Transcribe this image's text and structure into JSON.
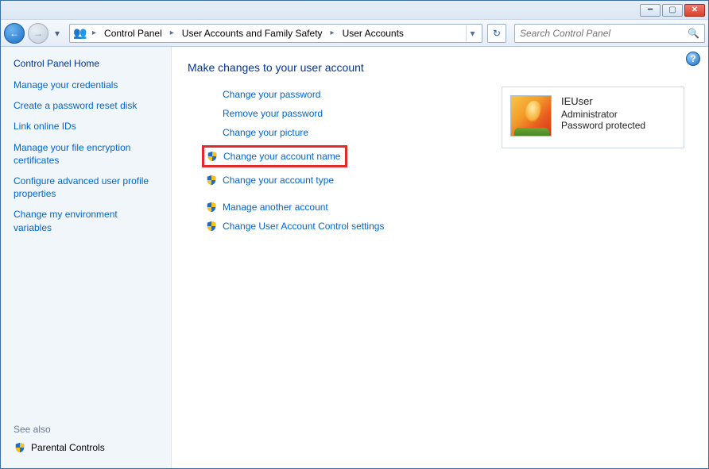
{
  "breadcrumb": {
    "items": [
      "Control Panel",
      "User Accounts and Family Safety",
      "User Accounts"
    ]
  },
  "search": {
    "placeholder": "Search Control Panel"
  },
  "sidebar": {
    "home": "Control Panel Home",
    "links": [
      "Manage your credentials",
      "Create a password reset disk",
      "Link online IDs",
      "Manage your file encryption certificates",
      "Configure advanced user profile properties",
      "Change my environment variables"
    ],
    "see_also": "See also",
    "parental": "Parental Controls"
  },
  "main": {
    "heading": "Make changes to your user account",
    "group1": [
      {
        "label": "Change your password",
        "shield": false
      },
      {
        "label": "Remove your password",
        "shield": false
      },
      {
        "label": "Change your picture",
        "shield": false
      },
      {
        "label": "Change your account name",
        "shield": true,
        "highlighted": true
      },
      {
        "label": "Change your account type",
        "shield": true
      }
    ],
    "group2": [
      {
        "label": "Manage another account",
        "shield": true
      },
      {
        "label": "Change User Account Control settings",
        "shield": true
      }
    ]
  },
  "user": {
    "name": "IEUser",
    "role": "Administrator",
    "protection": "Password protected"
  }
}
